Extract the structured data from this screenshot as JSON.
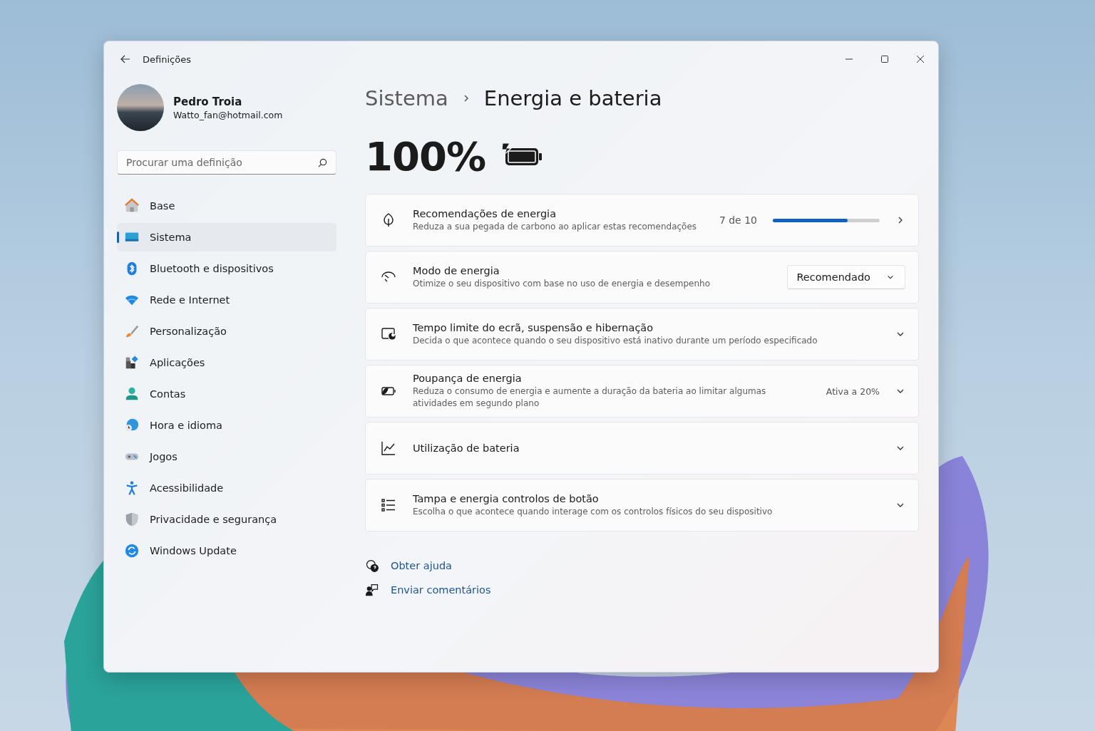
{
  "window": {
    "title": "Definições"
  },
  "user": {
    "name": "Pedro Troia",
    "email": "Watto_fan@hotmail.com"
  },
  "search": {
    "placeholder": "Procurar uma definição"
  },
  "nav": [
    {
      "label": "Base",
      "selected": false
    },
    {
      "label": "Sistema",
      "selected": true
    },
    {
      "label": "Bluetooth e dispositivos",
      "selected": false
    },
    {
      "label": "Rede e Internet",
      "selected": false
    },
    {
      "label": "Personalização",
      "selected": false
    },
    {
      "label": "Aplicações",
      "selected": false
    },
    {
      "label": "Contas",
      "selected": false
    },
    {
      "label": "Hora e idioma",
      "selected": false
    },
    {
      "label": "Jogos",
      "selected": false
    },
    {
      "label": "Acessibilidade",
      "selected": false
    },
    {
      "label": "Privacidade e segurança",
      "selected": false
    },
    {
      "label": "Windows Update",
      "selected": false
    }
  ],
  "breadcrumb": [
    "Sistema",
    "Energia e bateria"
  ],
  "battery": {
    "percent": "100%",
    "charging": true
  },
  "cards": [
    {
      "kind": "progress",
      "title": "Recomendações de energia",
      "subtitle": "Reduza a sua pegada de carbono ao aplicar estas recomendações",
      "reading": "7 de 10",
      "level": 0.7
    },
    {
      "kind": "dropdown",
      "title": "Modo de energia",
      "subtitle": "Otimize o seu dispositivo com base no uso de energia e desempenho",
      "value": "Recomendado"
    },
    {
      "kind": "expander",
      "title": "Tempo limite do ecrã, suspensão e hibernação",
      "subtitle": "Decida o que acontece quando o seu dispositivo está inativo durante um período especificado",
      "expanded": false
    },
    {
      "kind": "expander",
      "title": "Poupança de energia",
      "subtitle": "Reduza o consumo de energia e aumente a duração da bateria ao limitar algumas atividades em segundo plano",
      "status": "Ativa a 20%",
      "expanded": false
    },
    {
      "kind": "expander",
      "title": "Utilização de bateria",
      "expanded": false
    },
    {
      "kind": "expander",
      "title": "Tampa e energia controlos de botão",
      "subtitle": "Escolha o que acontece quando interage com os controlos físicos do seu dispositivo",
      "expanded": false
    }
  ],
  "links": [
    {
      "label": "Obter ajuda"
    },
    {
      "label": "Enviar comentários"
    }
  ]
}
